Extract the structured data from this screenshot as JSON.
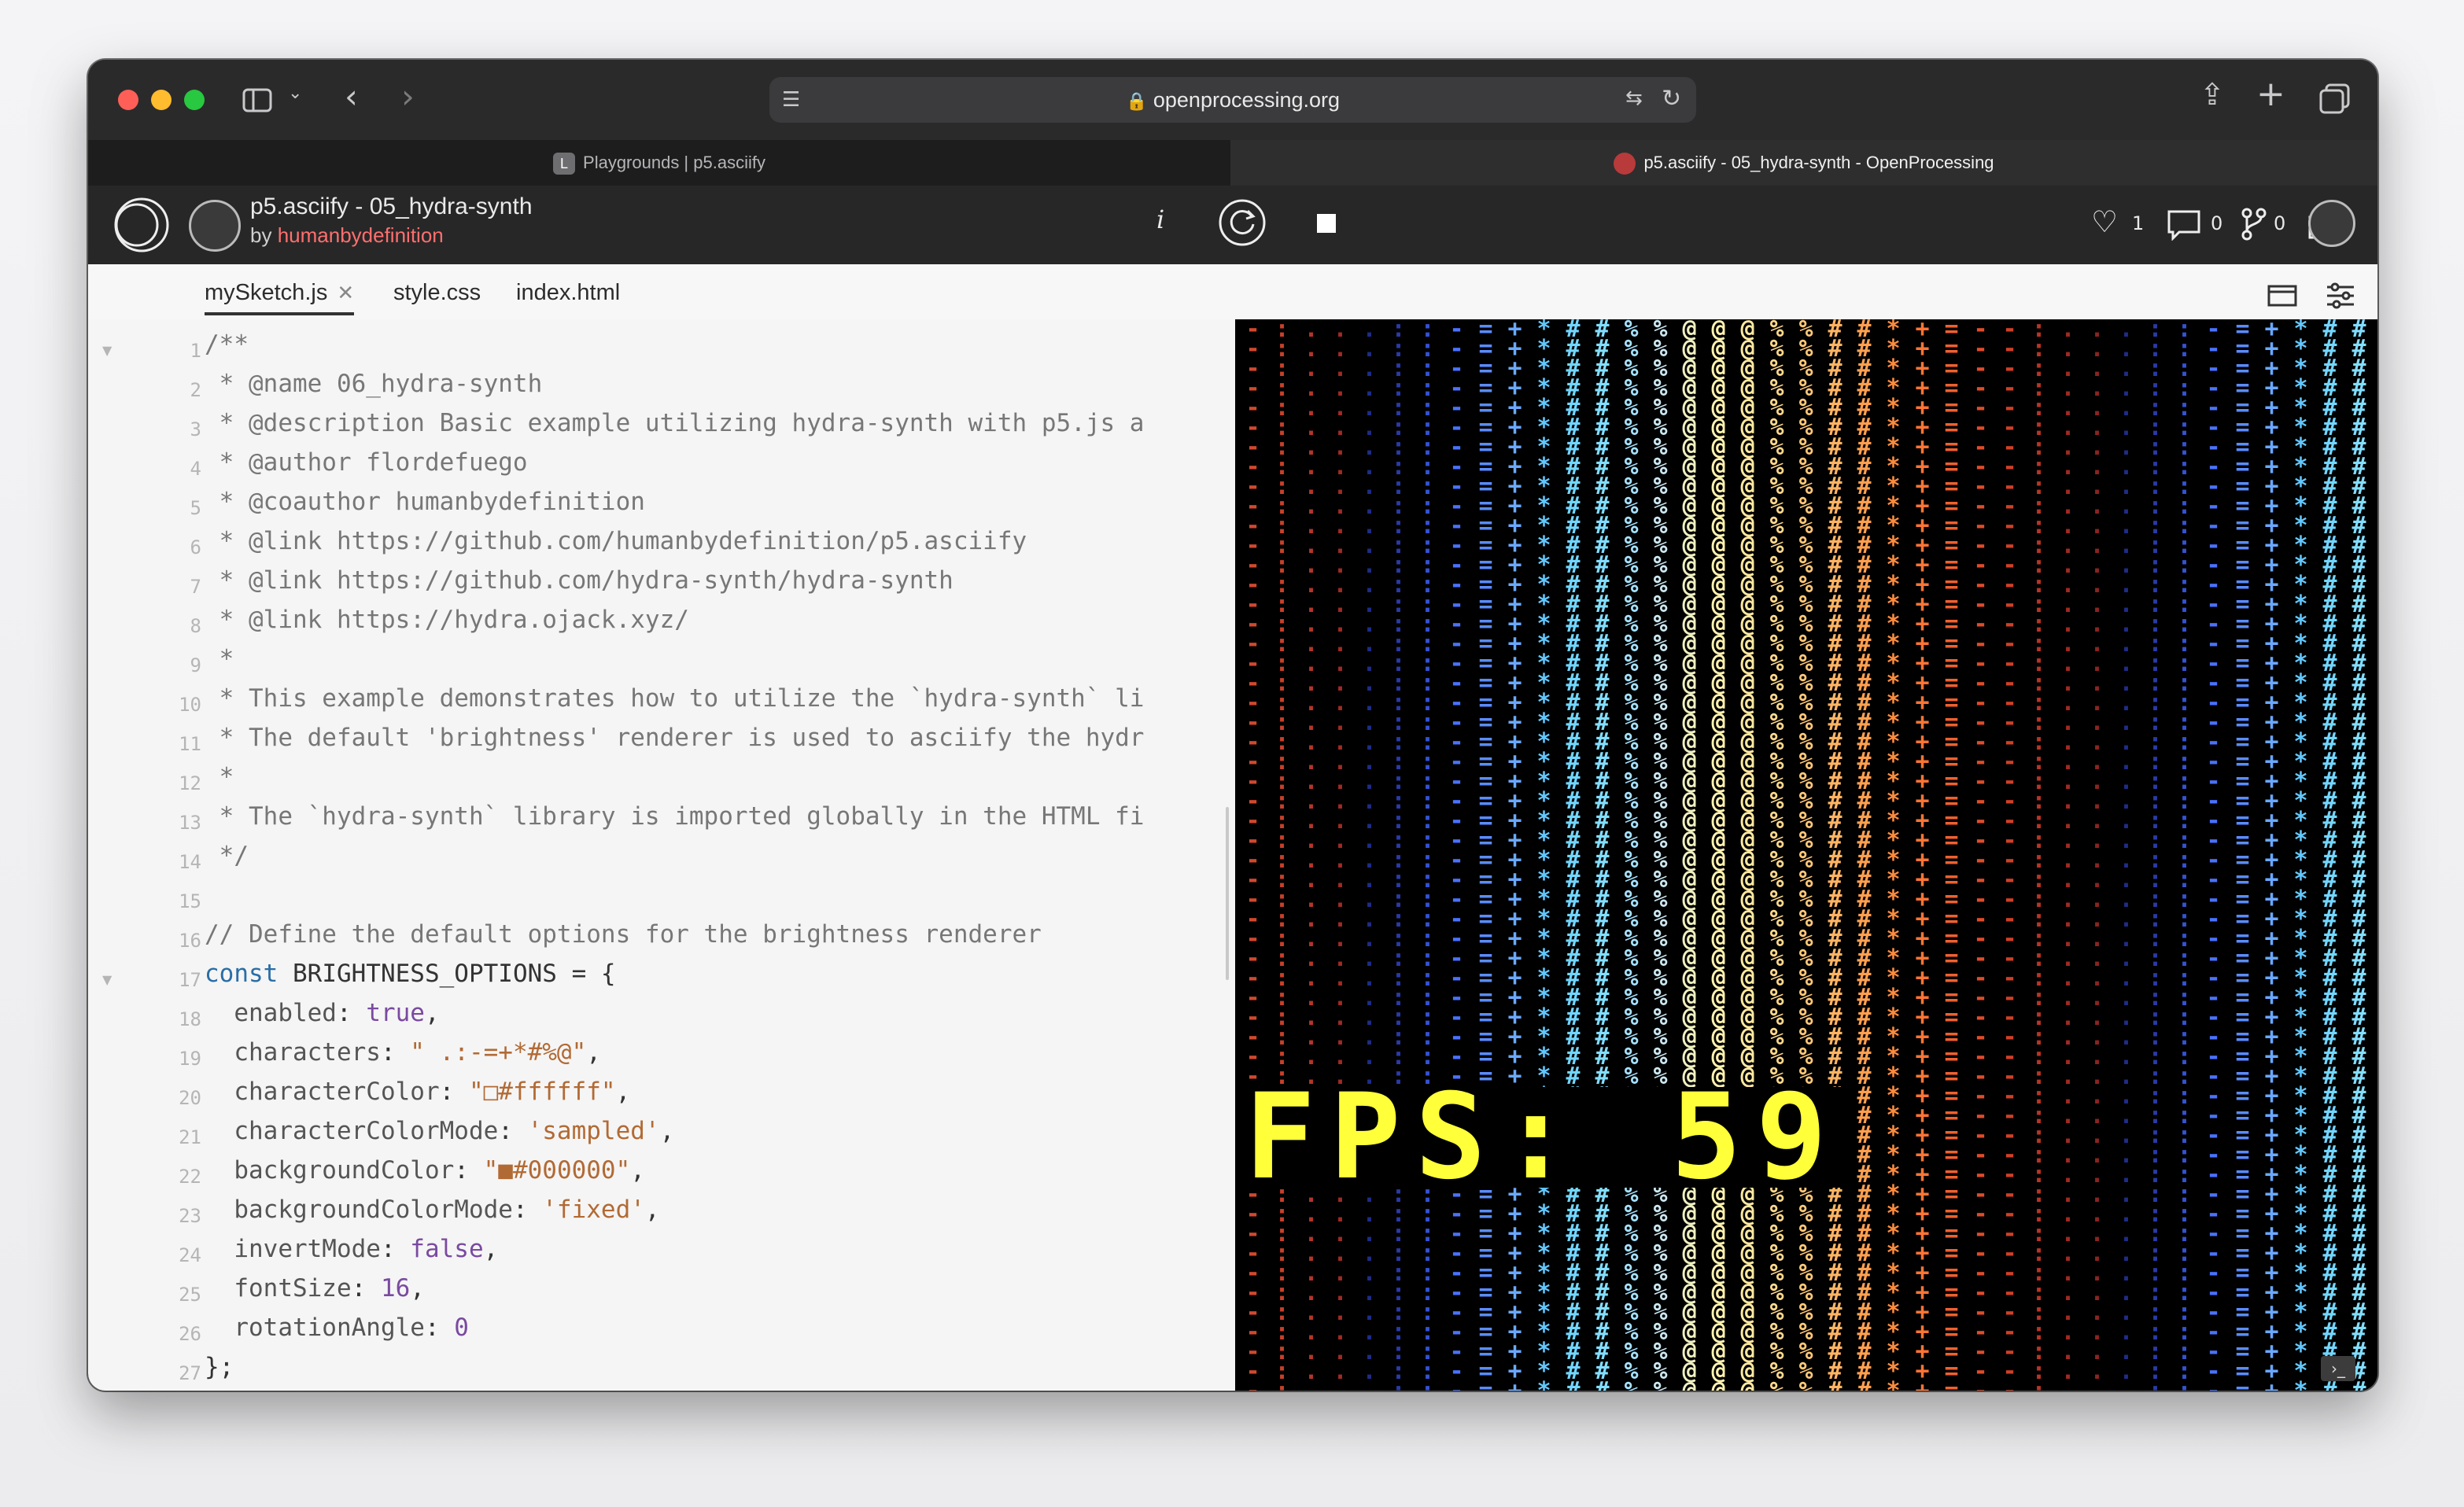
{
  "browser": {
    "url": "openprocessing.org",
    "tabs": [
      {
        "label": "Playgrounds | p5.asciify",
        "favicon": "L"
      },
      {
        "label": "p5.asciify - 05_hydra-synth - OpenProcessing"
      }
    ]
  },
  "sketch": {
    "title": "p5.asciify - 05_hydra-synth",
    "by_label": "by",
    "author": "humanbydefinition",
    "info_label": "i",
    "likes": "1",
    "comments": "0",
    "forks": "0"
  },
  "files": [
    "mySketch.js",
    "style.css",
    "index.html"
  ],
  "code": {
    "line_numbers": [
      "1",
      "2",
      "3",
      "4",
      "5",
      "6",
      "7",
      "8",
      "9",
      "10",
      "11",
      "12",
      "13",
      "14",
      "15",
      "16",
      "17",
      "18",
      "19",
      "20",
      "21",
      "22",
      "23",
      "24",
      "25",
      "26",
      "27"
    ],
    "lines": [
      "/**",
      " * @name 06_hydra-synth",
      " * @description Basic example utilizing hydra-synth with p5.js a",
      " * @author flordefuego",
      " * @coauthor humanbydefinition",
      " * @link https://github.com/humanbydefinition/p5.asciify",
      " * @link https://github.com/hydra-synth/hydra-synth",
      " * @link https://hydra.ojack.xyz/",
      " *",
      " * This example demonstrates how to utilize the `hydra-synth` li",
      " * The default 'brightness' renderer is used to asciify the hydr",
      " *",
      " * The `hydra-synth` library is imported globally in the HTML fi",
      " */",
      "",
      "// Define the default options for the brightness renderer"
    ],
    "const_kw": "const",
    "const_name": " BRIGHTNESS_OPTIONS = {",
    "opts": [
      {
        "key": "enabled",
        "value": "true",
        "kind": "val"
      },
      {
        "key": "characters",
        "value": "\" .:-=+*#%@\"",
        "kind": "str"
      },
      {
        "key": "characterColor",
        "value": "\"□#ffffff\"",
        "kind": "str"
      },
      {
        "key": "characterColorMode",
        "value": "'sampled'",
        "kind": "str"
      },
      {
        "key": "backgroundColor",
        "value": "\"■#000000\"",
        "kind": "str"
      },
      {
        "key": "backgroundColorMode",
        "value": "'fixed'",
        "kind": "str"
      },
      {
        "key": "invertMode",
        "value": "false",
        "kind": "val"
      },
      {
        "key": "fontSize",
        "value": "16",
        "kind": "val"
      },
      {
        "key": "rotationAngle",
        "value": "0",
        "kind": "val"
      }
    ],
    "close": "};"
  },
  "canvas": {
    "fps_text": "FPS: 59",
    "columns": [
      {
        "ch": "-",
        "color": "#d2482e"
      },
      {
        "ch": ":",
        "color": "#c8402a"
      },
      {
        "ch": ".",
        "color": "#b5352a"
      },
      {
        "ch": ".",
        "color": "#a02a26"
      },
      {
        "ch": ".",
        "color": "#1e2c8a"
      },
      {
        "ch": ":",
        "color": "#2a3aa8"
      },
      {
        "ch": ":",
        "color": "#3452d4"
      },
      {
        "ch": "-",
        "color": "#4a72ff"
      },
      {
        "ch": "=",
        "color": "#5a8cff"
      },
      {
        "ch": "+",
        "color": "#6aa8ff"
      },
      {
        "ch": "*",
        "color": "#62c8ff"
      },
      {
        "ch": "#",
        "color": "#72d6ff"
      },
      {
        "ch": "#",
        "color": "#82deff"
      },
      {
        "ch": "%",
        "color": "#a6e2ff"
      },
      {
        "ch": "%",
        "color": "#cce8f2"
      },
      {
        "ch": "@",
        "color": "#f0f0c0"
      },
      {
        "ch": "@",
        "color": "#fff3b0"
      },
      {
        "ch": "@",
        "color": "#ffe9a0"
      },
      {
        "ch": "%",
        "color": "#ffd98c"
      },
      {
        "ch": "%",
        "color": "#ffc878"
      },
      {
        "ch": "#",
        "color": "#ffb464"
      },
      {
        "ch": "#",
        "color": "#ffa050"
      },
      {
        "ch": "*",
        "color": "#ff8c3e"
      },
      {
        "ch": "+",
        "color": "#ff7434"
      },
      {
        "ch": "=",
        "color": "#f0602e"
      },
      {
        "ch": "-",
        "color": "#e04c2a"
      },
      {
        "ch": "-",
        "color": "#d04026"
      },
      {
        "ch": ":",
        "color": "#b83424"
      },
      {
        "ch": ".",
        "color": "#a02a22"
      },
      {
        "ch": ".",
        "color": "#8c2420"
      },
      {
        "ch": ".",
        "color": "#1e2c8a"
      },
      {
        "ch": ":",
        "color": "#2a3aa8"
      },
      {
        "ch": ":",
        "color": "#3452d4"
      },
      {
        "ch": "-",
        "color": "#4a72ff"
      },
      {
        "ch": "=",
        "color": "#5a8cff"
      },
      {
        "ch": "+",
        "color": "#6aa8ff"
      },
      {
        "ch": "*",
        "color": "#62c8ff"
      },
      {
        "ch": "#",
        "color": "#72d6ff"
      },
      {
        "ch": "#",
        "color": "#82deff"
      }
    ]
  }
}
